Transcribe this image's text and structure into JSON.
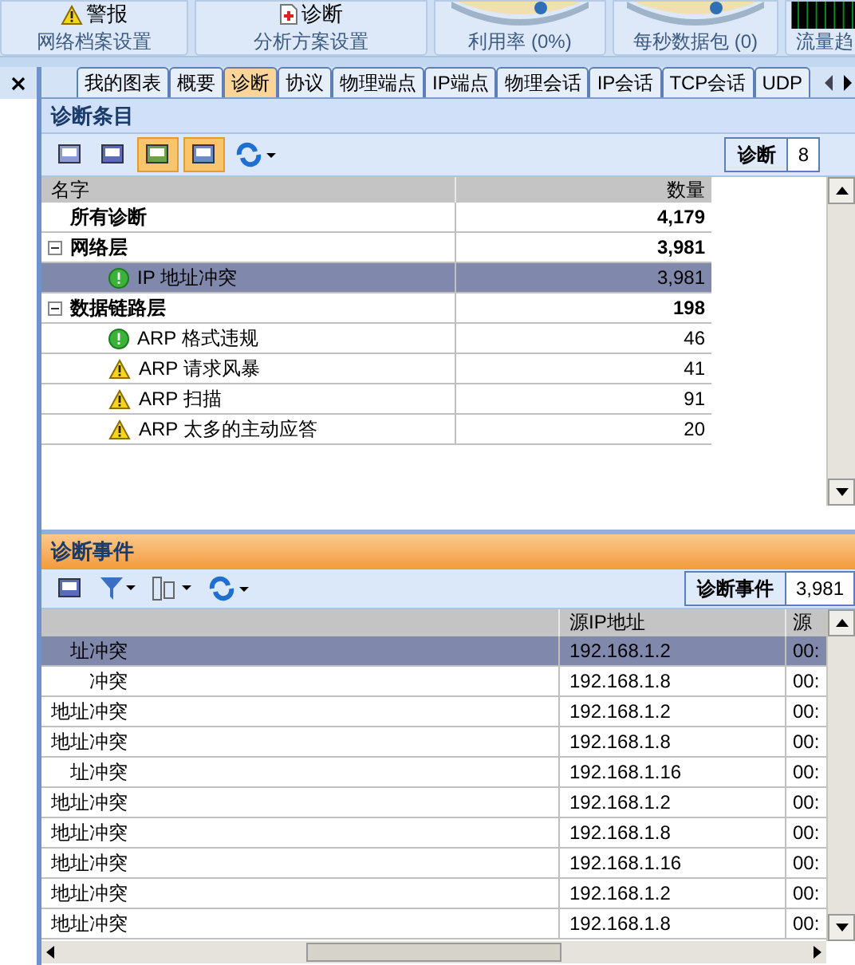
{
  "ribbon": {
    "groups": [
      {
        "kind": "button",
        "button": "警报",
        "label": "网络档案设置"
      },
      {
        "kind": "button",
        "button": "诊断",
        "label": "分析方案设置"
      },
      {
        "kind": "gauge",
        "label": "利用率 (0%)"
      },
      {
        "kind": "gauge",
        "label": "每秒数据包 (0)"
      },
      {
        "kind": "graph",
        "label": "流量趋"
      }
    ]
  },
  "tabs": [
    {
      "label": "我的图表",
      "selected": false
    },
    {
      "label": "概要",
      "selected": false
    },
    {
      "label": "诊断",
      "selected": true
    },
    {
      "label": "协议",
      "selected": false
    },
    {
      "label": "物理端点",
      "selected": false
    },
    {
      "label": "IP端点",
      "selected": false
    },
    {
      "label": "物理会话",
      "selected": false
    },
    {
      "label": "IP会话",
      "selected": false
    },
    {
      "label": "TCP会话",
      "selected": false
    },
    {
      "label": "UDP",
      "selected": false
    }
  ],
  "diagnosis_items": {
    "title": "诊断条目",
    "counter_label": "诊断",
    "counter_value": "8",
    "columns": [
      "名字",
      "数量"
    ],
    "rows": [
      {
        "name": "所有诊断",
        "count": "4,179",
        "group": true,
        "selected": false
      },
      {
        "name": "网络层",
        "count": "3,981",
        "group": true,
        "expanded": true,
        "selected": false,
        "children": [
          {
            "name": "IP 地址冲突",
            "count": "3,981",
            "kind": "ok",
            "selected": true
          }
        ]
      },
      {
        "name": "数据链路层",
        "count": "198",
        "group": true,
        "expanded": true,
        "selected": false,
        "children": [
          {
            "name": "ARP 格式违规",
            "count": "46",
            "kind": "ok",
            "selected": false
          },
          {
            "name": "ARP 请求风暴",
            "count": "41",
            "kind": "warning",
            "selected": false
          },
          {
            "name": "ARP 扫描",
            "count": "91",
            "kind": "warning",
            "selected": false
          },
          {
            "name": "ARP 太多的主动应答",
            "count": "20",
            "kind": "warning",
            "selected": false
          }
        ]
      }
    ]
  },
  "diagnosis_events": {
    "title": "诊断事件",
    "counter_label": "诊断事件",
    "counter_value": "3,981",
    "columns": [
      "",
      "源IP地址",
      "源"
    ],
    "rows": [
      {
        "cells": [
          "址冲突",
          "192.168.1.2",
          "00:"
        ],
        "selected": true
      },
      {
        "cells": [
          "冲突",
          "192.168.1.8",
          "00:"
        ],
        "selected": false
      },
      {
        "cells": [
          "地址冲突",
          "192.168.1.2",
          "00:"
        ],
        "selected": false
      },
      {
        "cells": [
          "地址冲突",
          "192.168.1.8",
          "00:"
        ],
        "selected": false
      },
      {
        "cells": [
          "址冲突",
          "192.168.1.16",
          "00:"
        ],
        "selected": false
      },
      {
        "cells": [
          "地址冲突",
          "192.168.1.2",
          "00:"
        ],
        "selected": false
      },
      {
        "cells": [
          "地址冲突",
          "192.168.1.8",
          "00:"
        ],
        "selected": false
      },
      {
        "cells": [
          "地址冲突",
          "192.168.1.16",
          "00:"
        ],
        "selected": false
      },
      {
        "cells": [
          "地址冲突",
          "192.168.1.2",
          "00:"
        ],
        "selected": false
      },
      {
        "cells": [
          "地址冲突",
          "192.168.1.8",
          "00:"
        ],
        "selected": false
      }
    ]
  }
}
